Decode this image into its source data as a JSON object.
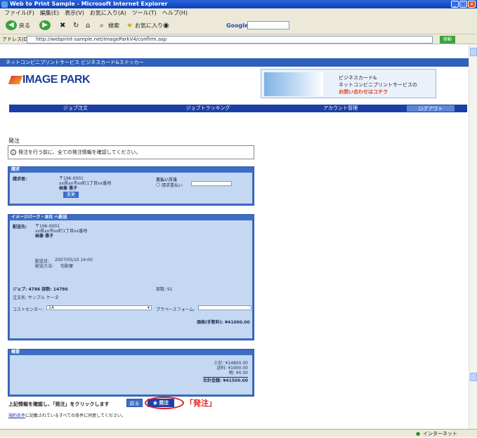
{
  "window": {
    "title": "Web to Print Sample - Microsoft Internet Explorer"
  },
  "menu": [
    "ファイル(F)",
    "編集(E)",
    "表示(V)",
    "お気に入り(A)",
    "ツール(T)",
    "ヘルプ(H)"
  ],
  "toolbar": {
    "back": "戻る",
    "search": "検索",
    "favorites": "お気に入り",
    "google": "Google"
  },
  "address": {
    "label": "アドレス(D)",
    "url": "http://webprint-sample.net/ImageParkV4/confirm.asp",
    "go": "移動"
  },
  "site": {
    "strip": "ネットコンビニプリントサービス ビジネスカード&ステッカー",
    "logo": "IMAGE PARK",
    "banner_line1": "ビジネスカード&",
    "banner_line2": "ネットコンビニプリントサービスの",
    "banner_line3": "お問い合わせはコチラ",
    "nav": [
      "ジョブ注文",
      "ジョブトラッキング",
      "アカウント管理"
    ],
    "logout": "ログアウト"
  },
  "page": {
    "title": "発注",
    "notice": "発注を行う前に、全ての発注情報を確認してください。"
  },
  "request": {
    "header": "請求",
    "label": "請求者:",
    "postal": "〒196-0001",
    "address": "xx県xx市xx町1丁目xx番地",
    "name": "画像 雅子",
    "edit_btn": "変更",
    "pay_label": "支払い方法",
    "pay_option": "請求書払い"
  },
  "delivery": {
    "header": "イメージパーク・本社 へ配送",
    "label": "配送先:",
    "postal": "〒196-0001",
    "address": "xx県xx市xx町1丁目xx番地",
    "name": "画像 雅子",
    "date_label": "配送日:",
    "date_value": "2007/05/10 14:00",
    "method_label": "配送方法:",
    "method_value": "宅配便",
    "job_label": "ジョブ: 4786 部数: 14786",
    "qty_label": "部数: 91",
    "note_label": "注文名: サンプル ケータ",
    "cost_center_label": "コストセンター:",
    "cost_center_value": "1A",
    "po_label": "プラペースフォーム:",
    "price_label": "価格(手数料): ¥41000.00"
  },
  "summary": {
    "header": "概要",
    "subtotal": "小計: ¥14800.00",
    "shipping": "送料: ¥1900.00",
    "tax": "税: ¥0.00",
    "total": "合計金額: ¥41500.00"
  },
  "footer": {
    "confirm_text": "上記情報を確認し、「発注」をクリックします",
    "back_btn": "戻る",
    "order_btn": "発注",
    "callout": "「発注」",
    "terms_link": "規約条件",
    "terms_text": "に記載されているすべての条件に同意してください。"
  },
  "status": {
    "left": "",
    "zone": "インターネット"
  }
}
